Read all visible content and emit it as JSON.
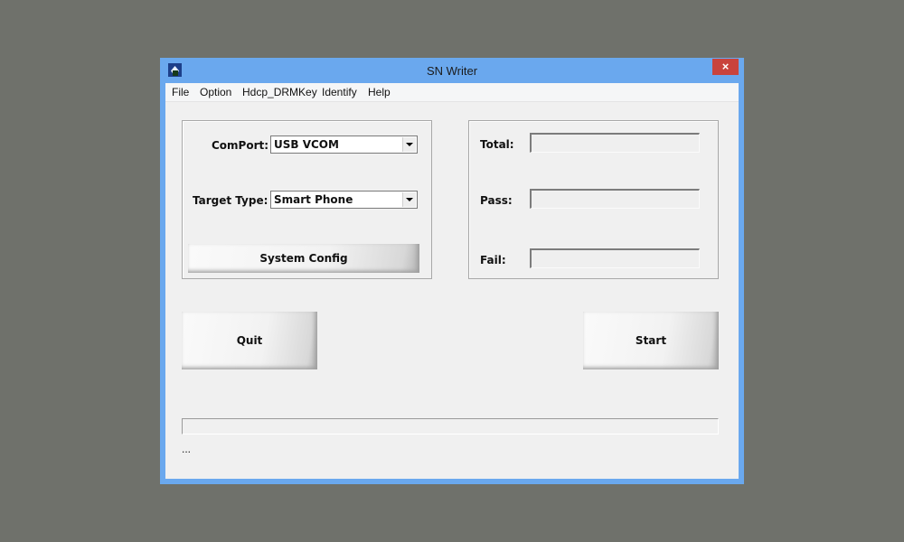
{
  "window": {
    "title": "SN Writer",
    "icon": "app-logo-icon",
    "close_icon": "×"
  },
  "menu": {
    "items": [
      "File",
      "Option",
      "Hdcp_DRMKey",
      "Identify",
      "Help"
    ]
  },
  "settings": {
    "comport_label": "ComPort:",
    "comport_value": "USB VCOM",
    "target_type_label": "Target Type:",
    "target_type_value": "Smart Phone",
    "system_config_label": "System Config"
  },
  "stats": {
    "total_label": "Total:",
    "total_value": "",
    "pass_label": "Pass:",
    "pass_value": "",
    "fail_label": "Fail:",
    "fail_value": ""
  },
  "actions": {
    "quit_label": "Quit",
    "start_label": "Start"
  },
  "progress": {
    "value_percent": 0
  },
  "status": {
    "text": "..."
  }
}
